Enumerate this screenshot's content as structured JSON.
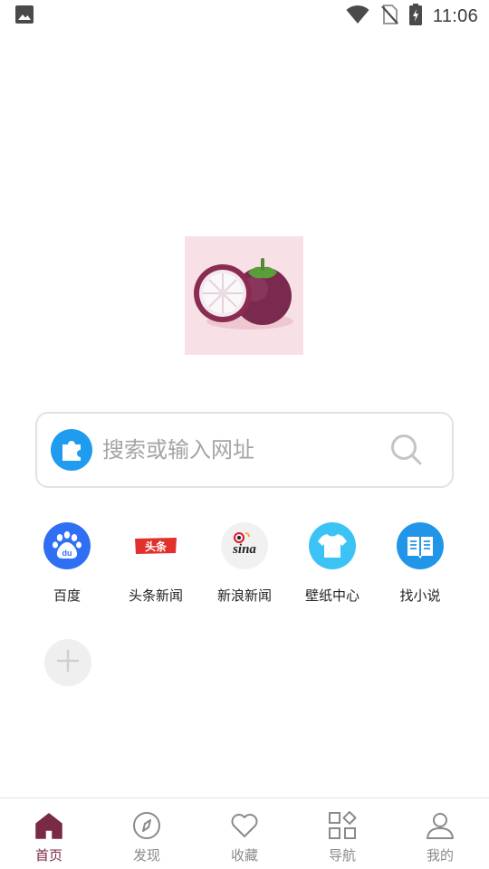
{
  "status_bar": {
    "time": "11:06",
    "icons": [
      "image-icon",
      "wifi-icon",
      "no-sim-icon",
      "battery-charging-icon"
    ]
  },
  "logo": {
    "icon": "mangosteen-logo",
    "bg_color": "#f8e1e6"
  },
  "search": {
    "engine_icon": "puzzle-icon",
    "placeholder": "搜索或输入网址",
    "value": "",
    "button_icon": "search-icon"
  },
  "shortcuts": [
    {
      "label": "百度",
      "icon": "baidu-icon",
      "color": "#2f6ff3"
    },
    {
      "label": "头条新闻",
      "icon": "toutiao-icon",
      "color": "#e0312c"
    },
    {
      "label": "新浪新闻",
      "icon": "sina-icon",
      "color": "#e6162d"
    },
    {
      "label": "壁纸中心",
      "icon": "tshirt-icon",
      "color": "#3cc3f5"
    },
    {
      "label": "找小说",
      "icon": "book-icon",
      "color": "#2196e8"
    }
  ],
  "add_shortcut": {
    "icon": "plus-icon"
  },
  "bottom_nav": {
    "active_color": "#7b2a45",
    "items": [
      {
        "label": "首页",
        "icon": "home-icon",
        "active": true
      },
      {
        "label": "发现",
        "icon": "compass-icon",
        "active": false
      },
      {
        "label": "收藏",
        "icon": "heart-icon",
        "active": false
      },
      {
        "label": "导航",
        "icon": "grid-icon",
        "active": false
      },
      {
        "label": "我的",
        "icon": "user-icon",
        "active": false
      }
    ]
  }
}
